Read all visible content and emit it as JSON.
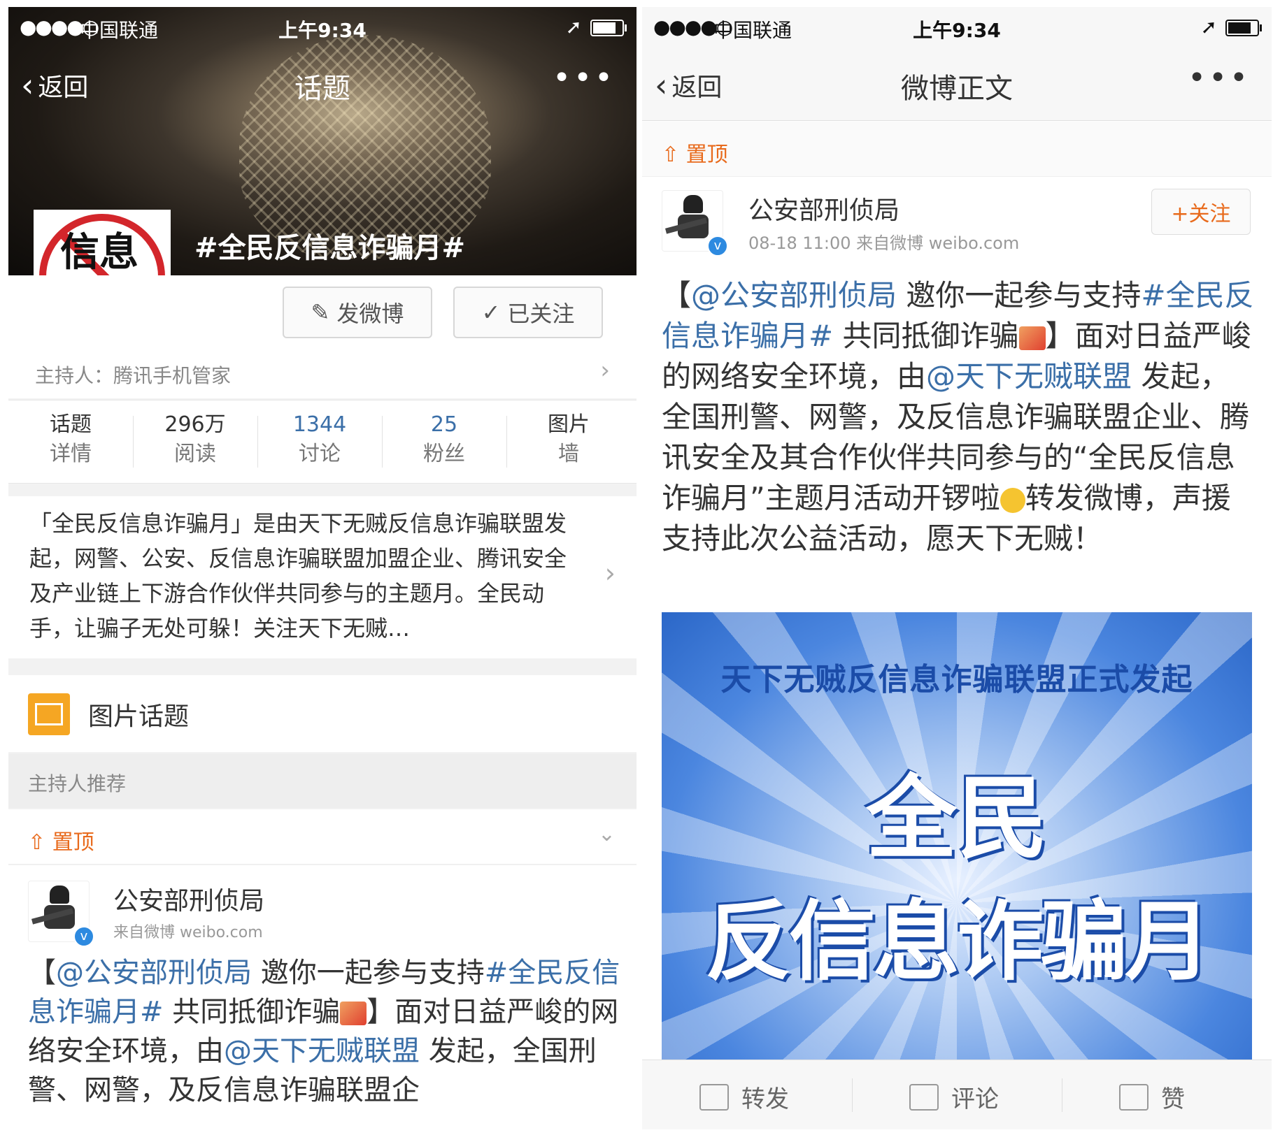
{
  "status": {
    "signal": "●●●●○",
    "carrier": "中国联通",
    "time": "上午9:34",
    "location_icon": "➚"
  },
  "left": {
    "nav": {
      "back": "返回",
      "title": "话题",
      "more": "•••"
    },
    "hero_tag": "#全民反信息诈骗月#",
    "logo_text": "信息诈骗",
    "buttons": {
      "post": "发微博",
      "followed": "已关注"
    },
    "host": "主持人：腾讯手机管家",
    "stats": [
      {
        "value": "话题",
        "label": "详情"
      },
      {
        "value": "296万",
        "label": "阅读"
      },
      {
        "value": "1344",
        "label": "讨论"
      },
      {
        "value": "25",
        "label": "粉丝"
      },
      {
        "value": "图片",
        "label": "墙"
      }
    ],
    "description": "「全民反信息诈骗月」是由天下无贼反信息诈骗联盟发起，网警、公安、反信息诈骗联盟加盟企业、腾讯安全及产业链上下游合作伙伴共同参与的主题月。全民动手，让骗子无处可躲！关注天下无贼…",
    "pic_topic": "图片话题",
    "recommend": "主持人推荐",
    "pinned": "置顶",
    "post": {
      "name": "公安部刑侦局",
      "source": "来自微博 weibo.com",
      "t1": "【",
      "mention": "@公安部刑侦局",
      "t2": " 邀你一起参与支持",
      "tag": "#全民反信息诈骗月#",
      "t3": " 共同抵御诈骗",
      "t4": "】面对日益严峻的网络安全环境，由",
      "mention2": "@天下无贼联盟",
      "t5": " 发起，全国刑警、网警，及反信息诈骗联盟企"
    }
  },
  "right": {
    "nav": {
      "back": "返回",
      "title": "微博正文",
      "more": "•••"
    },
    "pinned": "置顶",
    "follow": "+关注",
    "post": {
      "name": "公安部刑侦局",
      "meta": "08-18 11:00  来自微博 weibo.com",
      "t1": "【",
      "mention": "@公安部刑侦局",
      "t2": " 邀你一起参与支持",
      "tag": "#全民反信息诈骗月#",
      "t3": " 共同抵御诈骗",
      "t4": "】面对日益严峻的网络安全环境，由",
      "mention2": "@天下无贼联盟",
      "t5": " 发起，全国刑警、网警，及反信息诈骗联盟企业、腾讯安全及其合作伙伴共同参与的“全民反信息诈骗月”主题月活动开锣啦",
      "t6": "转发微博，声援支持此次公益活动，愿天下无贼！"
    },
    "poster": {
      "line1": "天下无贼反信息诈骗联盟正式发起",
      "line2": "全民",
      "line3": "反信息诈骗月"
    },
    "toolbar": {
      "repost": "转发",
      "comment": "评论",
      "like": "赞"
    }
  },
  "colors": {
    "accent": "#e86a1c",
    "link": "#3b6fa8"
  }
}
